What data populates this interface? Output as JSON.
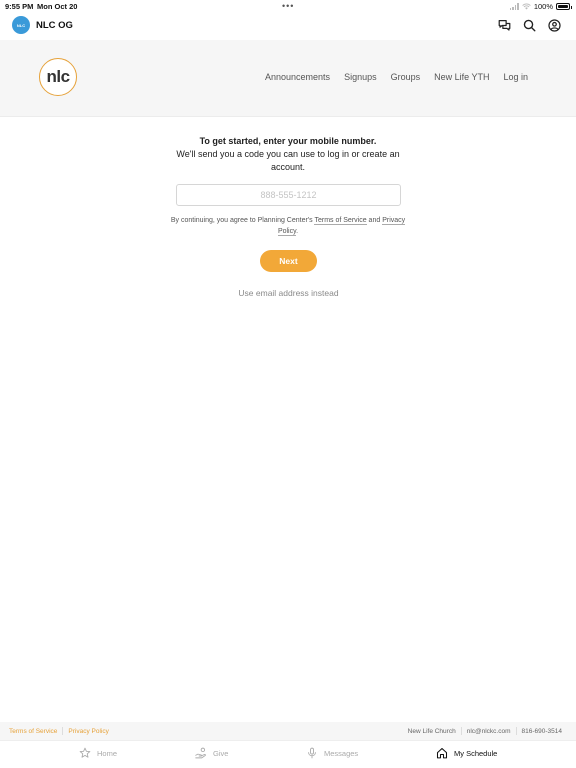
{
  "status_bar": {
    "time": "9:55 PM",
    "date": "Mon Oct 20",
    "dots": "•••",
    "battery": "100%"
  },
  "app_header": {
    "logo_text": "NLC",
    "title": "NLC OG",
    "icons": [
      "chat-bubbles-icon",
      "search-icon",
      "account-icon"
    ]
  },
  "site_nav": {
    "logo_text": "nlc",
    "links": [
      "Announcements",
      "Signups",
      "Groups",
      "New Life YTH",
      "Log in"
    ]
  },
  "login": {
    "intro_line1": "To get started, enter your mobile number.",
    "intro_line2": "We'll send you a code you can use to log in or create an account.",
    "phone_placeholder": "888-555-1212",
    "phone_value": "",
    "terms_prefix": "By continuing, you agree to Planning Center's ",
    "terms_link": "Terms of Service",
    "terms_middle": " and ",
    "privacy_link": "Privacy Policy",
    "terms_suffix": ".",
    "next_label": "Next",
    "email_alt": "Use email address instead"
  },
  "footer": {
    "terms": "Terms of Service",
    "privacy": "Privacy Policy",
    "church": "New Life Church",
    "email": "nlc@nlckc.com",
    "phone": "816-690-3514"
  },
  "tabs": [
    {
      "label": "Home",
      "icon": "star-icon",
      "active": false
    },
    {
      "label": "Give",
      "icon": "give-hand-icon",
      "active": false
    },
    {
      "label": "Messages",
      "icon": "microphone-icon",
      "active": false
    },
    {
      "label": "My Schedule",
      "icon": "home-icon",
      "active": true
    }
  ],
  "colors": {
    "accent": "#f2a838",
    "logo_blue": "#3a9ad9",
    "nav_background": "#f6f6f6"
  }
}
